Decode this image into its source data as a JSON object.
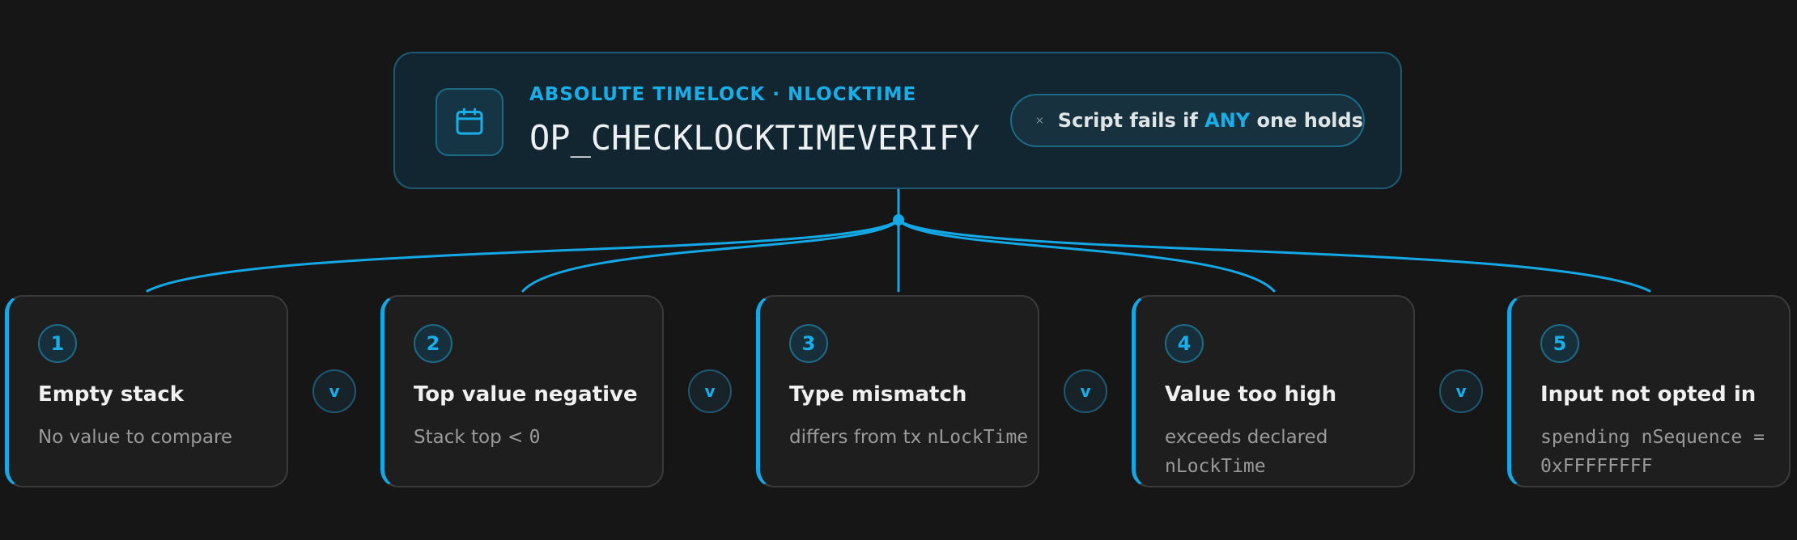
{
  "header": {
    "eyebrow": "ABSOLUTE TIMELOCK · NLOCKTIME",
    "title": "OP_CHECKLOCKTIMEVERIFY",
    "icon": "calendar-icon",
    "fail_pill": {
      "icon": "close-icon",
      "prefix": "Script fails if ",
      "accent": "ANY",
      "suffix": " one holds"
    }
  },
  "operator_label": "v",
  "conditions": [
    {
      "number": "1",
      "title": "Empty stack",
      "desc_text": "No value to compare",
      "desc_code": ""
    },
    {
      "number": "2",
      "title": "Top value negative",
      "desc_text": "Stack top < ",
      "desc_code": "0"
    },
    {
      "number": "3",
      "title": "Type mismatch",
      "desc_text": "differs from tx ",
      "desc_code": "nLockTime"
    },
    {
      "number": "4",
      "title": "Value too high",
      "desc_text": "exceeds declared ",
      "desc_code": "nLockTime"
    },
    {
      "number": "5",
      "title": "Input not opted in",
      "desc_text": "",
      "desc_code": "spending nSequence = 0xFFFFFFFF"
    }
  ],
  "colors": {
    "accent": "#1aaee8",
    "background": "#161616",
    "header_bg": "#112630",
    "card_bg": "#1e1e1e"
  }
}
